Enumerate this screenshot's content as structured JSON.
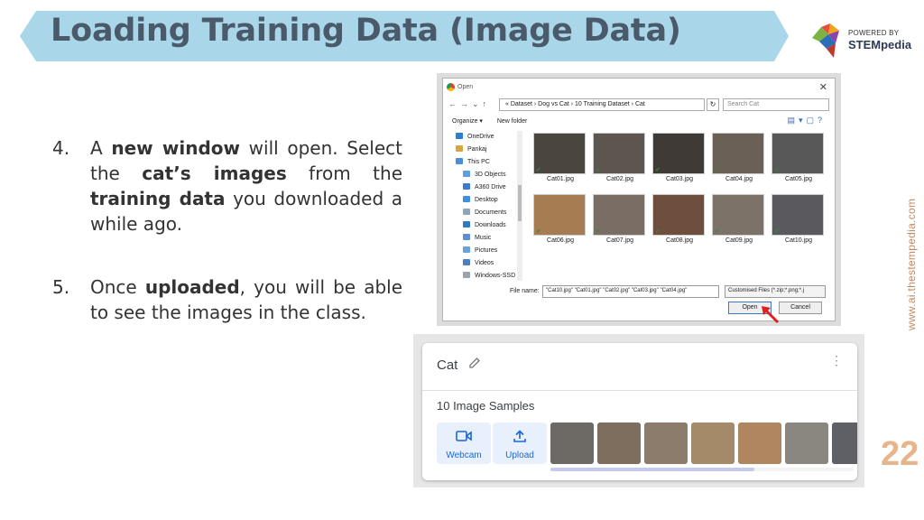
{
  "slide": {
    "title": "Loading Training Data (Image Data)",
    "logo_powered": "POWERED BY",
    "logo_name": "STEMpedia",
    "side_url": "www.ai.thestempedia.com",
    "page_number": "22"
  },
  "steps": [
    {
      "num": "4.",
      "parts": [
        "A ",
        "new window",
        " will open. Select the ",
        "cat’s images",
        " from the ",
        "training data",
        " you downloaded a while ago."
      ]
    },
    {
      "num": "5.",
      "parts": [
        "Once ",
        "uploaded",
        ", you will be able to see the images in the class."
      ]
    }
  ],
  "dialog": {
    "title": "Open",
    "address": "«  Dataset  ›  Dog vs Cat  ›  10 Training Dataset  ›  Cat",
    "search_placeholder": "Search Cat",
    "toolbar_organize": "Organize ▾",
    "toolbar_new_folder": "New folder",
    "nav_items": [
      "OneDrive",
      "Pankaj",
      "This PC",
      "3D Objects",
      "A360 Drive",
      "Desktop",
      "Documents",
      "Downloads",
      "Music",
      "Pictures",
      "Videos",
      "Windows-SSD"
    ],
    "files": [
      "Cat01.jpg",
      "Cat02.jpg",
      "Cat03.jpg",
      "Cat04.jpg",
      "Cat05.jpg",
      "Cat06.jpg",
      "Cat07.jpg",
      "Cat08.jpg",
      "Cat09.jpg",
      "Cat10.jpg"
    ],
    "filename_label": "File name:",
    "filename_value": "\"Cat10.jpg\" \"Cat01.jpg\" \"Cat02.jpg\" \"Cat03.jpg\" \"Cat04.jpg\"",
    "filter_value": "Customised Files (*.zip;*.png;*.j",
    "open_label": "Open",
    "cancel_label": "Cancel"
  },
  "card": {
    "class_name": "Cat",
    "sample_count": "10 Image Samples",
    "webcam_label": "Webcam",
    "upload_label": "Upload",
    "sample_colors": [
      "#6d6a66",
      "#7d6e5e",
      "#8c7c6c",
      "#a58a6a",
      "#b08660",
      "#8a8680",
      "#5f5f66"
    ]
  },
  "thumb_colors": [
    "#4b4540",
    "#5c5550",
    "#3f3a36",
    "#6b6055",
    "#585858",
    "#a67c52",
    "#7a6e64",
    "#6e4f3e",
    "#7d7268",
    "#5a5a5e"
  ],
  "colors": {
    "banner": "#a9d6e8",
    "title": "#4a5a6a",
    "accent": "#e8b48c"
  }
}
